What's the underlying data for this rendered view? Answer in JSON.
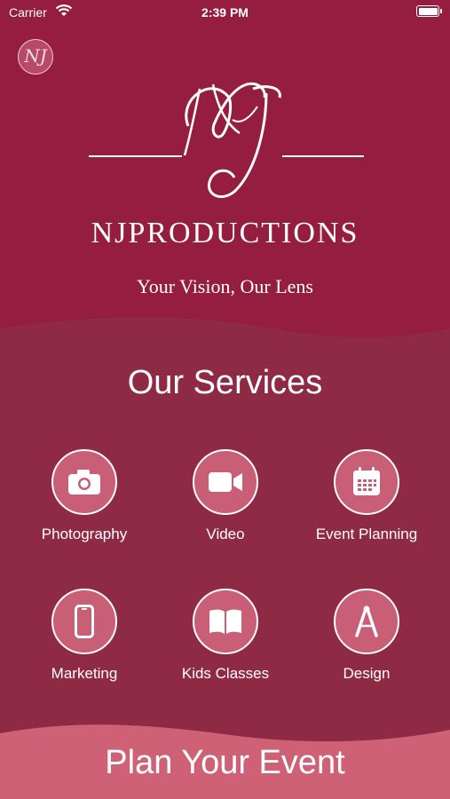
{
  "status": {
    "carrier": "Carrier",
    "time": "2:39 PM"
  },
  "logo": {
    "monogram": "NJ"
  },
  "brand": {
    "name": "NJPRODUCTIONS",
    "tagline": "Your Vision, Our Lens"
  },
  "services": {
    "title": "Our Services",
    "items": [
      {
        "label": "Photography",
        "icon": "camera-icon"
      },
      {
        "label": "Video",
        "icon": "video-camera-icon"
      },
      {
        "label": "Event Planning",
        "icon": "calendar-icon"
      },
      {
        "label": "Marketing",
        "icon": "smartphone-icon"
      },
      {
        "label": "Kids Classes",
        "icon": "open-book-icon"
      },
      {
        "label": "Design",
        "icon": "compass-icon"
      }
    ]
  },
  "cta": {
    "label": "Plan Your Event"
  },
  "colors": {
    "background": "#951d3f",
    "panel": "#8f2a44",
    "circle": "#c95f76",
    "cta": "#cf6177"
  }
}
